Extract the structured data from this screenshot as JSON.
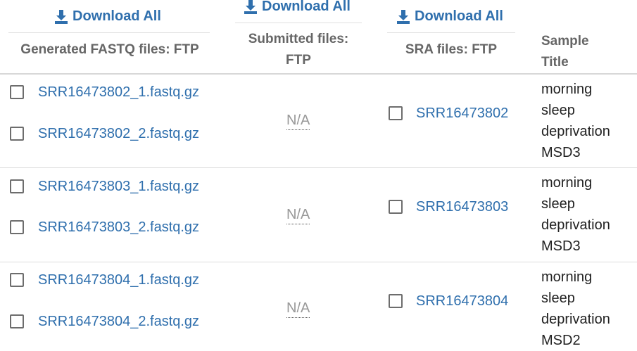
{
  "header": {
    "download_all_label": "Download All",
    "fastq_col": "Generated FASTQ files: FTP",
    "submitted_col_line1": "Submitted files:",
    "submitted_col_line2": "FTP",
    "sra_col": "SRA files: FTP",
    "title_col_line1": "Sample",
    "title_col_line2": "Title"
  },
  "rows": [
    {
      "fastq_1": "SRR16473802_1.fastq.gz",
      "fastq_2": "SRR16473802_2.fastq.gz",
      "submitted": "N/A",
      "sra": "SRR16473802",
      "title_lines": [
        "morning",
        "sleep",
        "deprivation",
        "MSD3"
      ]
    },
    {
      "fastq_1": "SRR16473803_1.fastq.gz",
      "fastq_2": "SRR16473803_2.fastq.gz",
      "submitted": "N/A",
      "sra": "SRR16473803",
      "title_lines": [
        "morning",
        "sleep",
        "deprivation",
        "MSD3"
      ]
    },
    {
      "fastq_1": "SRR16473804_1.fastq.gz",
      "fastq_2": "SRR16473804_2.fastq.gz",
      "submitted": "N/A",
      "sra": "SRR16473804",
      "title_lines": [
        "morning",
        "sleep",
        "deprivation",
        "MSD2"
      ]
    }
  ]
}
